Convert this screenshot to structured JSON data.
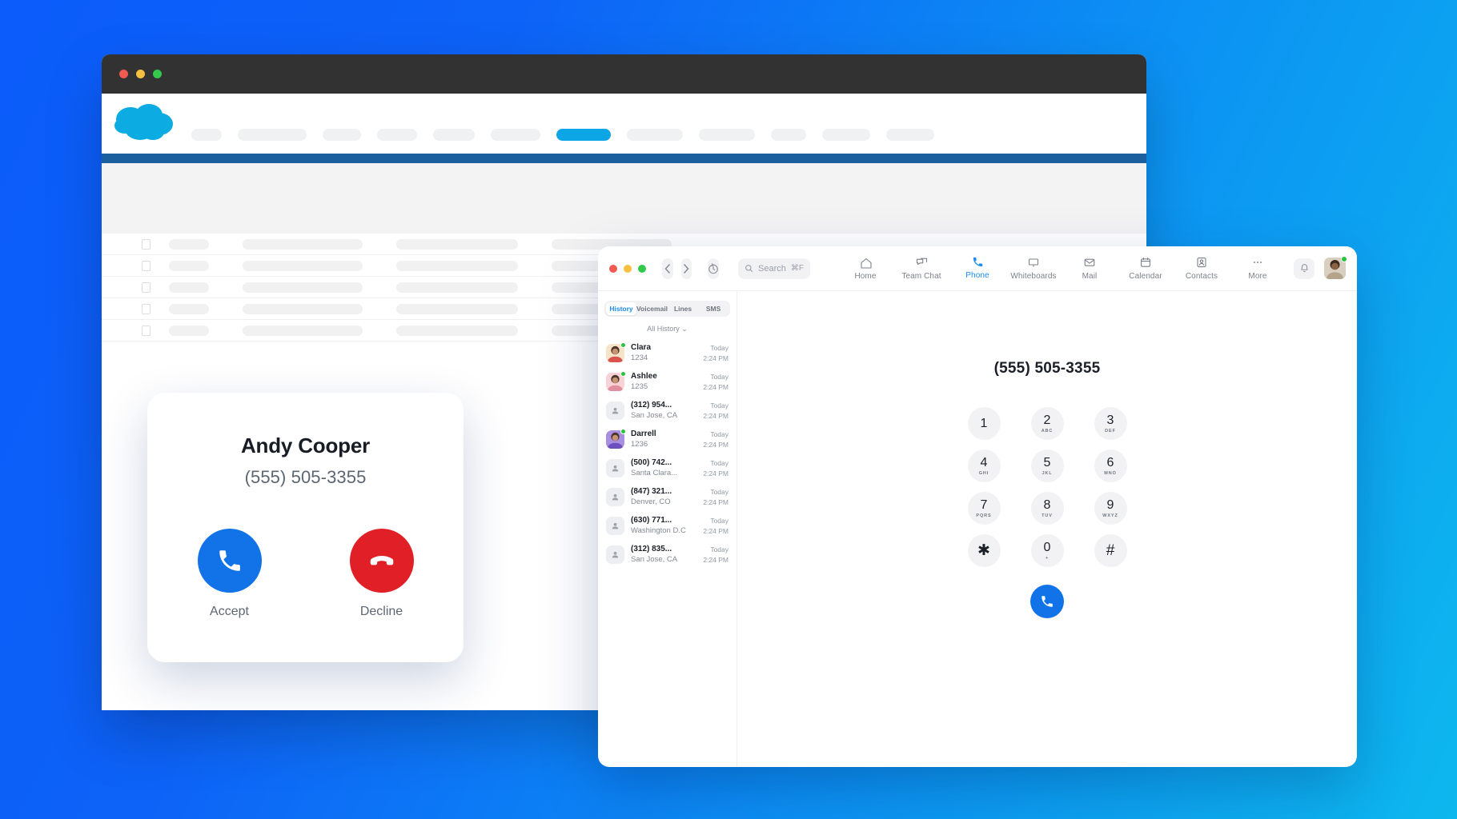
{
  "background_window": {
    "name": "crm-browser-window",
    "traffic_lights": [
      "close",
      "minimize",
      "maximize"
    ],
    "logo": "cloud-logo",
    "nav_skeleton_widths": [
      38,
      86,
      48,
      50,
      52,
      62,
      68,
      70,
      70,
      44,
      60,
      60
    ],
    "active_nav_index": 6,
    "table_rows": 5,
    "table_cell_widths": [
      50,
      150,
      152,
      150
    ]
  },
  "incoming_call": {
    "caller_name": "Andy Cooper",
    "caller_number": "(555) 505-3355",
    "accept_label": "Accept",
    "decline_label": "Decline",
    "accept_color": "#1272e8",
    "decline_color": "#e01f26"
  },
  "phone_app": {
    "traffic_lights": [
      "close",
      "minimize",
      "maximize"
    ],
    "back_label": "‹",
    "forward_label": "›",
    "history_icon": "recents-clock-icon",
    "search": {
      "placeholder": "Search",
      "shortcut": "⌘F"
    },
    "nav_items": [
      {
        "label": "Home",
        "icon": "home-icon",
        "active": false
      },
      {
        "label": "Team Chat",
        "icon": "chat-bubbles-icon",
        "active": false
      },
      {
        "label": "Phone",
        "icon": "phone-icon",
        "active": true
      },
      {
        "label": "Whiteboards",
        "icon": "whiteboard-icon",
        "active": false
      },
      {
        "label": "Mail",
        "icon": "mail-icon",
        "active": false
      },
      {
        "label": "Calendar",
        "icon": "calendar-icon",
        "active": false
      },
      {
        "label": "Contacts",
        "icon": "contacts-icon",
        "active": false
      },
      {
        "label": "More",
        "icon": "ellipsis-icon",
        "active": false
      }
    ],
    "bell_icon": "bell-icon",
    "avatar": {
      "name": "user-avatar",
      "presence": "available"
    },
    "accent_color": "#1a8cf0",
    "tabs": [
      {
        "label": "History",
        "active": true
      },
      {
        "label": "Voicemail",
        "active": false
      },
      {
        "label": "Lines",
        "active": false
      },
      {
        "label": "SMS",
        "active": false
      }
    ],
    "filter_label": "All History ⌄",
    "history": [
      {
        "title": "Clara",
        "sub": "1234",
        "day": "Today",
        "time": "2:24 PM",
        "has_avatar": true,
        "presence": true,
        "avatar_color_a": "#f7e3c8",
        "avatar_color_b": "#d9534f"
      },
      {
        "title": "Ashlee",
        "sub": "1235",
        "day": "Today",
        "time": "2:24 PM",
        "has_avatar": true,
        "presence": true,
        "avatar_color_a": "#f8d2d6",
        "avatar_color_b": "#e08f9c"
      },
      {
        "title": "(312) 954...",
        "sub": "San Jose, CA",
        "day": "Today",
        "time": "2:24 PM",
        "has_avatar": false,
        "presence": false,
        "avatar_color_a": "",
        "avatar_color_b": ""
      },
      {
        "title": "Darrell",
        "sub": "1236",
        "day": "Today",
        "time": "2:24 PM",
        "has_avatar": true,
        "presence": true,
        "avatar_color_a": "#a98fe0",
        "avatar_color_b": "#6d4fc0"
      },
      {
        "title": "(500) 742...",
        "sub": "Santa Clara...",
        "day": "Today",
        "time": "2:24 PM",
        "has_avatar": false,
        "presence": false,
        "avatar_color_a": "",
        "avatar_color_b": ""
      },
      {
        "title": "(847) 321...",
        "sub": "Denver, CO",
        "day": "Today",
        "time": "2:24 PM",
        "has_avatar": false,
        "presence": false,
        "avatar_color_a": "",
        "avatar_color_b": ""
      },
      {
        "title": "(630) 771...",
        "sub": "Washington D.C",
        "day": "Today",
        "time": "2:24 PM",
        "has_avatar": false,
        "presence": false,
        "avatar_color_a": "",
        "avatar_color_b": ""
      },
      {
        "title": "(312) 835...",
        "sub": "San Jose, CA",
        "day": "Today",
        "time": "2:24 PM",
        "has_avatar": false,
        "presence": false,
        "avatar_color_a": "",
        "avatar_color_b": ""
      }
    ],
    "dialer": {
      "number": "(555) 505-3355",
      "keys": [
        {
          "digit": "1",
          "letters": ""
        },
        {
          "digit": "2",
          "letters": "ABC"
        },
        {
          "digit": "3",
          "letters": "DEF"
        },
        {
          "digit": "4",
          "letters": "GHI"
        },
        {
          "digit": "5",
          "letters": "JKL"
        },
        {
          "digit": "6",
          "letters": "MNO"
        },
        {
          "digit": "7",
          "letters": "PQRS"
        },
        {
          "digit": "8",
          "letters": "TUV"
        },
        {
          "digit": "9",
          "letters": "WXYZ"
        },
        {
          "digit": "✱",
          "letters": ""
        },
        {
          "digit": "0",
          "letters": "+"
        },
        {
          "digit": "#",
          "letters": ""
        }
      ],
      "call_button_icon": "phone-icon",
      "call_button_color": "#1272e8"
    }
  },
  "theme": {
    "bg_gradient_start": "#0b5cfb",
    "bg_gradient_end": "#0db8ee"
  }
}
